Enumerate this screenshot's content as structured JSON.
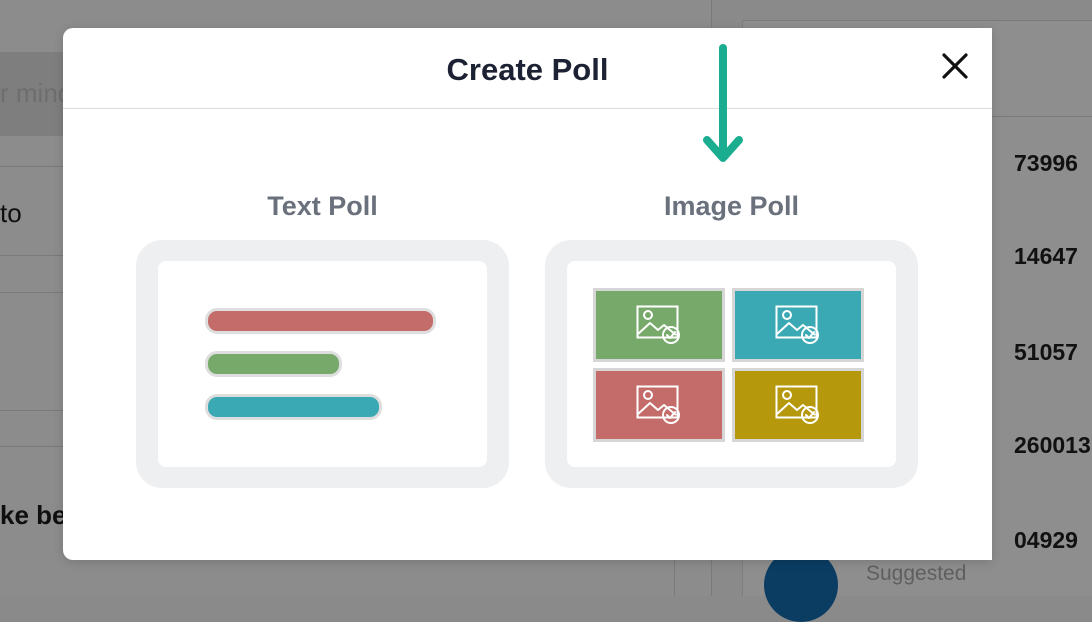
{
  "background": {
    "composer_placeholder": "r mind",
    "left_texts": [
      {
        "text": "to",
        "bold": false
      },
      {
        "text": "ke be",
        "bold": true
      }
    ],
    "right_numbers": [
      "73996",
      "14647",
      "51057",
      "260013",
      "04929"
    ],
    "suggested_label": "Suggested"
  },
  "modal": {
    "title": "Create Poll",
    "close_icon": "close-icon",
    "arrow_color": "#1aad8f",
    "options": [
      {
        "label": "Text Poll",
        "bars": [
          {
            "color": "#c46c6a",
            "fraction": 1.0
          },
          {
            "color": "#76a96a",
            "fraction": 0.58
          },
          {
            "color": "#3ba9b4",
            "fraction": 0.76
          }
        ]
      },
      {
        "label": "Image Poll",
        "tiles": [
          {
            "color": "#76a96a",
            "icon": "image-check-icon"
          },
          {
            "color": "#3ba9b4",
            "icon": "image-check-icon"
          },
          {
            "color": "#c46c6a",
            "icon": "image-check-icon"
          },
          {
            "color": "#b5980b",
            "icon": "image-check-icon"
          }
        ]
      }
    ]
  }
}
